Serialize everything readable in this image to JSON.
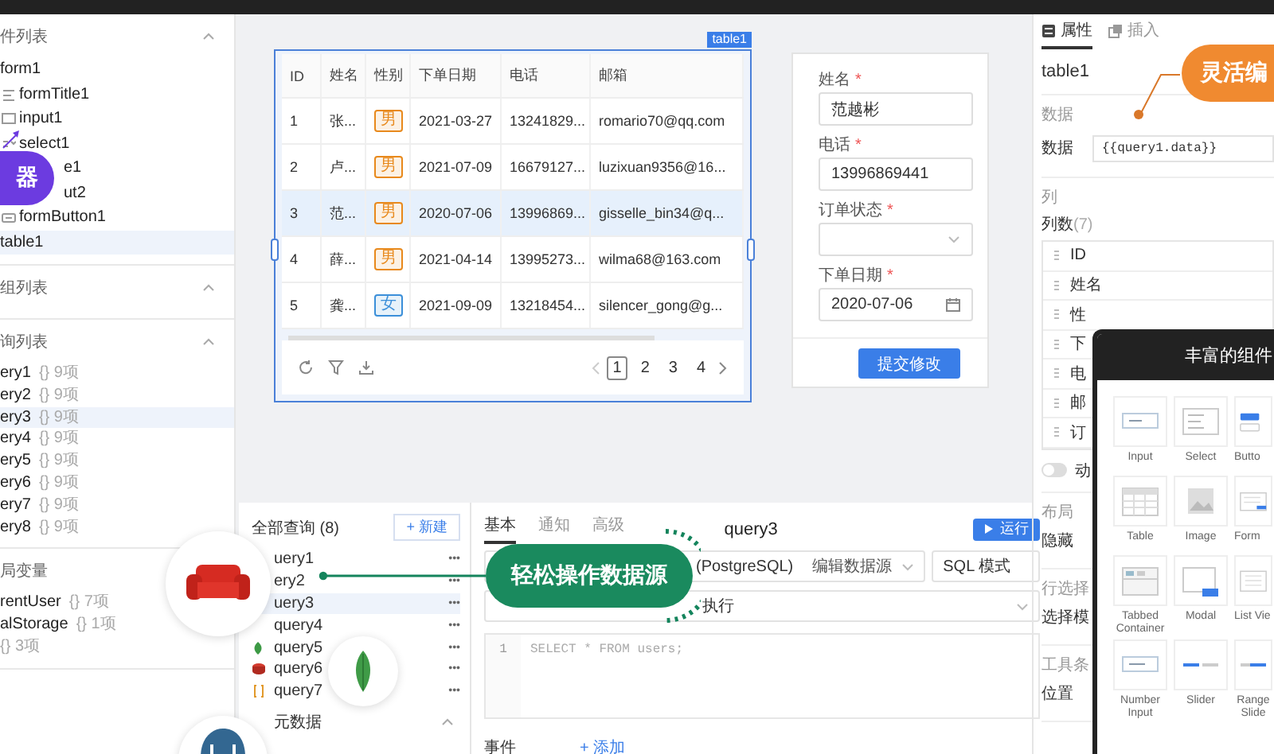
{
  "sidebar": {
    "sections": [
      {
        "kind": "tree",
        "title": "件列表",
        "items": [
          {
            "label": "form1",
            "selected": false,
            "children": [
              {
                "label": "formTitle1",
                "kind": "text",
                "selected": false
              },
              {
                "label": "input1",
                "kind": "input",
                "selected": false
              },
              {
                "label": "select1",
                "kind": "select",
                "selected": false
              },
              {
                "label": "e1",
                "kind": "plain",
                "selected": false
              },
              {
                "label": "ut2",
                "kind": "plain",
                "selected": false
              },
              {
                "label": "formButton1",
                "kind": "button",
                "selected": false
              }
            ]
          },
          {
            "label": "table1",
            "selected": true
          }
        ]
      },
      {
        "kind": "list",
        "title": "组列表"
      },
      {
        "kind": "list",
        "title": "询列表",
        "items": [
          {
            "label": "ery1",
            "meta": "{} 9项",
            "selected": false
          },
          {
            "label": "ery2",
            "meta": "{} 9项",
            "selected": false
          },
          {
            "label": "ery3",
            "meta": "{} 9项",
            "selected": true
          },
          {
            "label": "ery4",
            "meta": "{} 9项",
            "selected": false
          },
          {
            "label": "ery5",
            "meta": "{} 9项",
            "selected": false
          },
          {
            "label": "ery6",
            "meta": "{} 9项",
            "selected": false
          },
          {
            "label": "ery7",
            "meta": "{} 9项",
            "selected": false
          },
          {
            "label": "ery8",
            "meta": "{} 9项",
            "selected": false
          }
        ]
      },
      {
        "kind": "list",
        "title": "局变量",
        "items": [
          {
            "label": "rentUser",
            "meta": "{} 7项",
            "selected": false
          },
          {
            "label": "alStorage",
            "meta": "{} 1项",
            "selected": false
          },
          {
            "meta": "{} 3项",
            "selected": false
          }
        ]
      }
    ]
  },
  "canvas": {
    "table": {
      "tag": "table1",
      "columns": [
        "ID",
        "姓名",
        "性别",
        "下单日期",
        "电话",
        "邮箱"
      ],
      "rows": [
        {
          "selected": false,
          "cells": [
            {
              "kind": "text",
              "text": "1"
            },
            {
              "kind": "text",
              "text": "张..."
            },
            {
              "kind": "tag",
              "text": "男",
              "color": "#e8891c"
            },
            {
              "kind": "text",
              "text": "2021-03-27"
            },
            {
              "kind": "text",
              "text": "13241829..."
            },
            {
              "kind": "text",
              "text": "romario70@qq.com"
            }
          ]
        },
        {
          "selected": false,
          "cells": [
            {
              "kind": "text",
              "text": "2"
            },
            {
              "kind": "text",
              "text": "卢..."
            },
            {
              "kind": "tag",
              "text": "男",
              "color": "#e8891c"
            },
            {
              "kind": "text",
              "text": "2021-07-09"
            },
            {
              "kind": "text",
              "text": "16679127..."
            },
            {
              "kind": "text",
              "text": "luzixuan9356@16..."
            }
          ]
        },
        {
          "selected": true,
          "cells": [
            {
              "kind": "text",
              "text": "3"
            },
            {
              "kind": "text",
              "text": "范..."
            },
            {
              "kind": "tag",
              "text": "男",
              "color": "#e8891c"
            },
            {
              "kind": "text",
              "text": "2020-07-06"
            },
            {
              "kind": "text",
              "text": "13996869..."
            },
            {
              "kind": "text",
              "text": "gisselle_bin34@q..."
            }
          ]
        },
        {
          "selected": false,
          "cells": [
            {
              "kind": "text",
              "text": "4"
            },
            {
              "kind": "text",
              "text": "薛..."
            },
            {
              "kind": "tag",
              "text": "男",
              "color": "#e8891c"
            },
            {
              "kind": "text",
              "text": "2021-04-14"
            },
            {
              "kind": "text",
              "text": "13995273..."
            },
            {
              "kind": "text",
              "text": "wilma68@163.com"
            }
          ]
        },
        {
          "selected": false,
          "cells": [
            {
              "kind": "text",
              "text": "5"
            },
            {
              "kind": "text",
              "text": "龚..."
            },
            {
              "kind": "tag",
              "text": "女",
              "color": "#3b8fd9"
            },
            {
              "kind": "text",
              "text": "2021-09-09"
            },
            {
              "kind": "text",
              "text": "13218454..."
            },
            {
              "kind": "text",
              "text": "silencer_gong@g..."
            }
          ]
        }
      ],
      "pages": [
        {
          "label": "1",
          "selected": true
        },
        {
          "label": "2",
          "selected": false
        },
        {
          "label": "3",
          "selected": false
        },
        {
          "label": "4",
          "selected": false
        }
      ]
    },
    "form": {
      "fields": [
        {
          "kind": "input",
          "label": "姓名",
          "required_mark": "*",
          "value": "范越彬"
        },
        {
          "kind": "input",
          "label": "电话",
          "required_mark": "*",
          "value": "13996869441"
        },
        {
          "kind": "select",
          "label": "订单状态",
          "required_mark": "*"
        },
        {
          "kind": "date",
          "label": "下单日期",
          "required_mark": "*",
          "value": "2020-07-06"
        }
      ],
      "submit": "提交修改"
    }
  },
  "queries": {
    "title": "全部查询 (8)",
    "new_button": "+ 新建",
    "items": [
      {
        "label": "uery1",
        "kind": "plain",
        "menu": "•••",
        "selected": false
      },
      {
        "label": "ery2",
        "kind": "plain",
        "menu": "•••",
        "selected": false
      },
      {
        "label": "uery3",
        "kind": "plain",
        "menu": "•••",
        "selected": true
      },
      {
        "label": "query4",
        "kind": "plain",
        "menu": "•••",
        "selected": false
      },
      {
        "label": "query5",
        "kind": "leaf",
        "menu": "•••",
        "selected": false
      },
      {
        "label": "query6",
        "kind": "database",
        "menu": "•••",
        "selected": false
      },
      {
        "label": "query7",
        "kind": "braces",
        "menu": "•••",
        "selected": false
      }
    ],
    "footer": "元数据"
  },
  "editor": {
    "tabs": [
      {
        "label": "基本",
        "selected": true
      },
      {
        "label": "通知",
        "selected": false
      },
      {
        "label": "高级",
        "selected": false
      }
    ],
    "title": "query3",
    "run_button": "运行",
    "datasource": "(PostgreSQL)",
    "edit_link": "编辑数据源",
    "mode": "SQL 模式",
    "trigger": "执行",
    "code": [
      {
        "number": "1",
        "text": "SELECT * FROM users;"
      }
    ],
    "events_label": "事件",
    "add_link": "+ 添加"
  },
  "inspector": {
    "tabs": [
      {
        "label": "属性",
        "selected": true
      },
      {
        "label": "插入",
        "selected": false
      }
    ],
    "component": "table1",
    "data_title": "数据",
    "data_label": "数据",
    "data_value": "{{query1.data}}",
    "columns_title": "列",
    "count_label": "列数",
    "count": "(7)",
    "columns": [
      "ID",
      "姓名",
      "性",
      "下",
      "电",
      "邮",
      "订"
    ],
    "toggle": {
      "label": "动",
      "on": false
    },
    "sections": [
      {
        "title": "布局",
        "rows": [
          "隐藏"
        ]
      },
      {
        "title": "行选择",
        "rows": [
          "选择模"
        ]
      },
      {
        "title": "工具条",
        "rows": [
          "位置"
        ]
      }
    ]
  },
  "components_panel": {
    "title": "丰富的组件",
    "items": [
      {
        "kind": "input",
        "label": "Input"
      },
      {
        "kind": "select",
        "label": "Select"
      },
      {
        "kind": "button",
        "label": "Butto"
      },
      {
        "kind": "table",
        "label": "Table"
      },
      {
        "kind": "image",
        "label": "Image"
      },
      {
        "kind": "form",
        "label": "Form"
      },
      {
        "kind": "tabs",
        "label": "Tabbed Container"
      },
      {
        "kind": "modal",
        "label": "Modal"
      },
      {
        "kind": "list",
        "label": "List Vie"
      },
      {
        "kind": "number",
        "label": "Number Input"
      },
      {
        "kind": "slider",
        "label": "Slider"
      },
      {
        "kind": "range",
        "label": "Range Slide"
      }
    ]
  },
  "callouts": {
    "sidebar": "器",
    "edit": "灵活编",
    "datasource": "轻松操作数据源"
  }
}
